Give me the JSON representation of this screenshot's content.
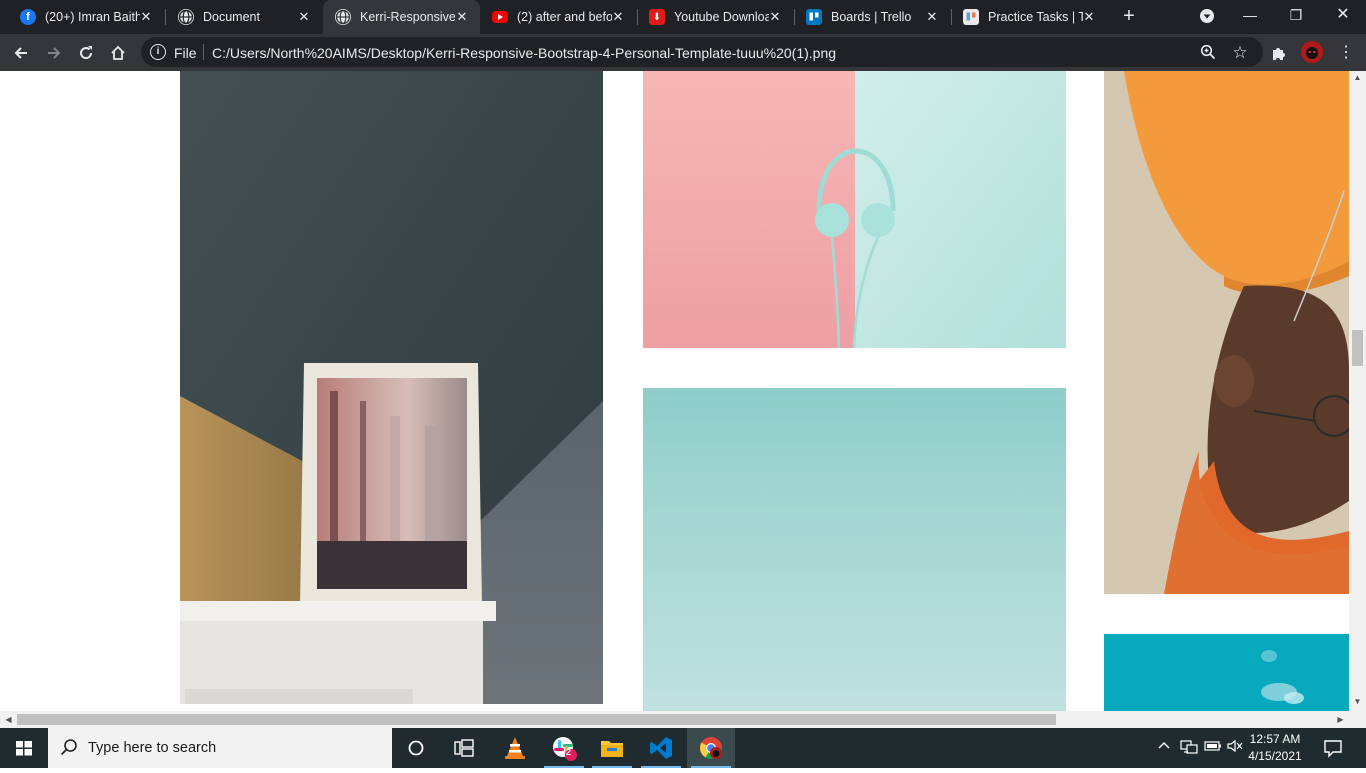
{
  "browser": {
    "tabs": [
      {
        "title": "(20+) Imran Baith",
        "icon": "facebook-icon",
        "active": false
      },
      {
        "title": "Document",
        "icon": "globe-icon",
        "active": false
      },
      {
        "title": "Kerri-Responsive-",
        "icon": "globe-icon",
        "active": true
      },
      {
        "title": "(2) after and befo",
        "icon": "youtube-icon",
        "active": false
      },
      {
        "title": "Youtube Downloa",
        "icon": "downloader-icon",
        "active": false
      },
      {
        "title": "Boards | Trello",
        "icon": "trello-icon",
        "active": false
      },
      {
        "title": "Practice Tasks | Tr",
        "icon": "trello-icon",
        "active": false
      }
    ],
    "address_bar": {
      "scheme_label": "File",
      "url": "C:/Users/North%20AIMS/Desktop/Kerri-Responsive-Bootstrap-4-Personal-Template-tuuu%20(1).png"
    },
    "colors": {
      "tab_strip": "#202124",
      "toolbar": "#35363a"
    }
  },
  "page": {
    "photos": [
      {
        "name": "framed-building-photo",
        "description_colors": [
          "#3c4a4f",
          "#b8955a",
          "#e9e6df"
        ]
      },
      {
        "name": "headphones-photo",
        "description_colors": [
          "#f1b1b3",
          "#c7e9e3",
          "#a8ddd9"
        ]
      },
      {
        "name": "mint-gradient-photo",
        "description_colors": [
          "#8fcfcb",
          "#bfe0de"
        ]
      },
      {
        "name": "orange-beanie-man-photo",
        "description_colors": [
          "#f09a3e",
          "#e06a2b",
          "#d8c9b4"
        ]
      },
      {
        "name": "sky-clouds-photo",
        "description_colors": [
          "#0aa8bd"
        ]
      }
    ]
  },
  "taskbar": {
    "search_placeholder": "Type here to search",
    "time": "12:57 AM",
    "date": "4/15/2021",
    "slack_badge": "2",
    "apps": [
      "cortana-icon",
      "task-view-icon",
      "vlc-icon",
      "slack-icon",
      "file-explorer-icon",
      "vscode-icon",
      "chrome-icon"
    ]
  }
}
